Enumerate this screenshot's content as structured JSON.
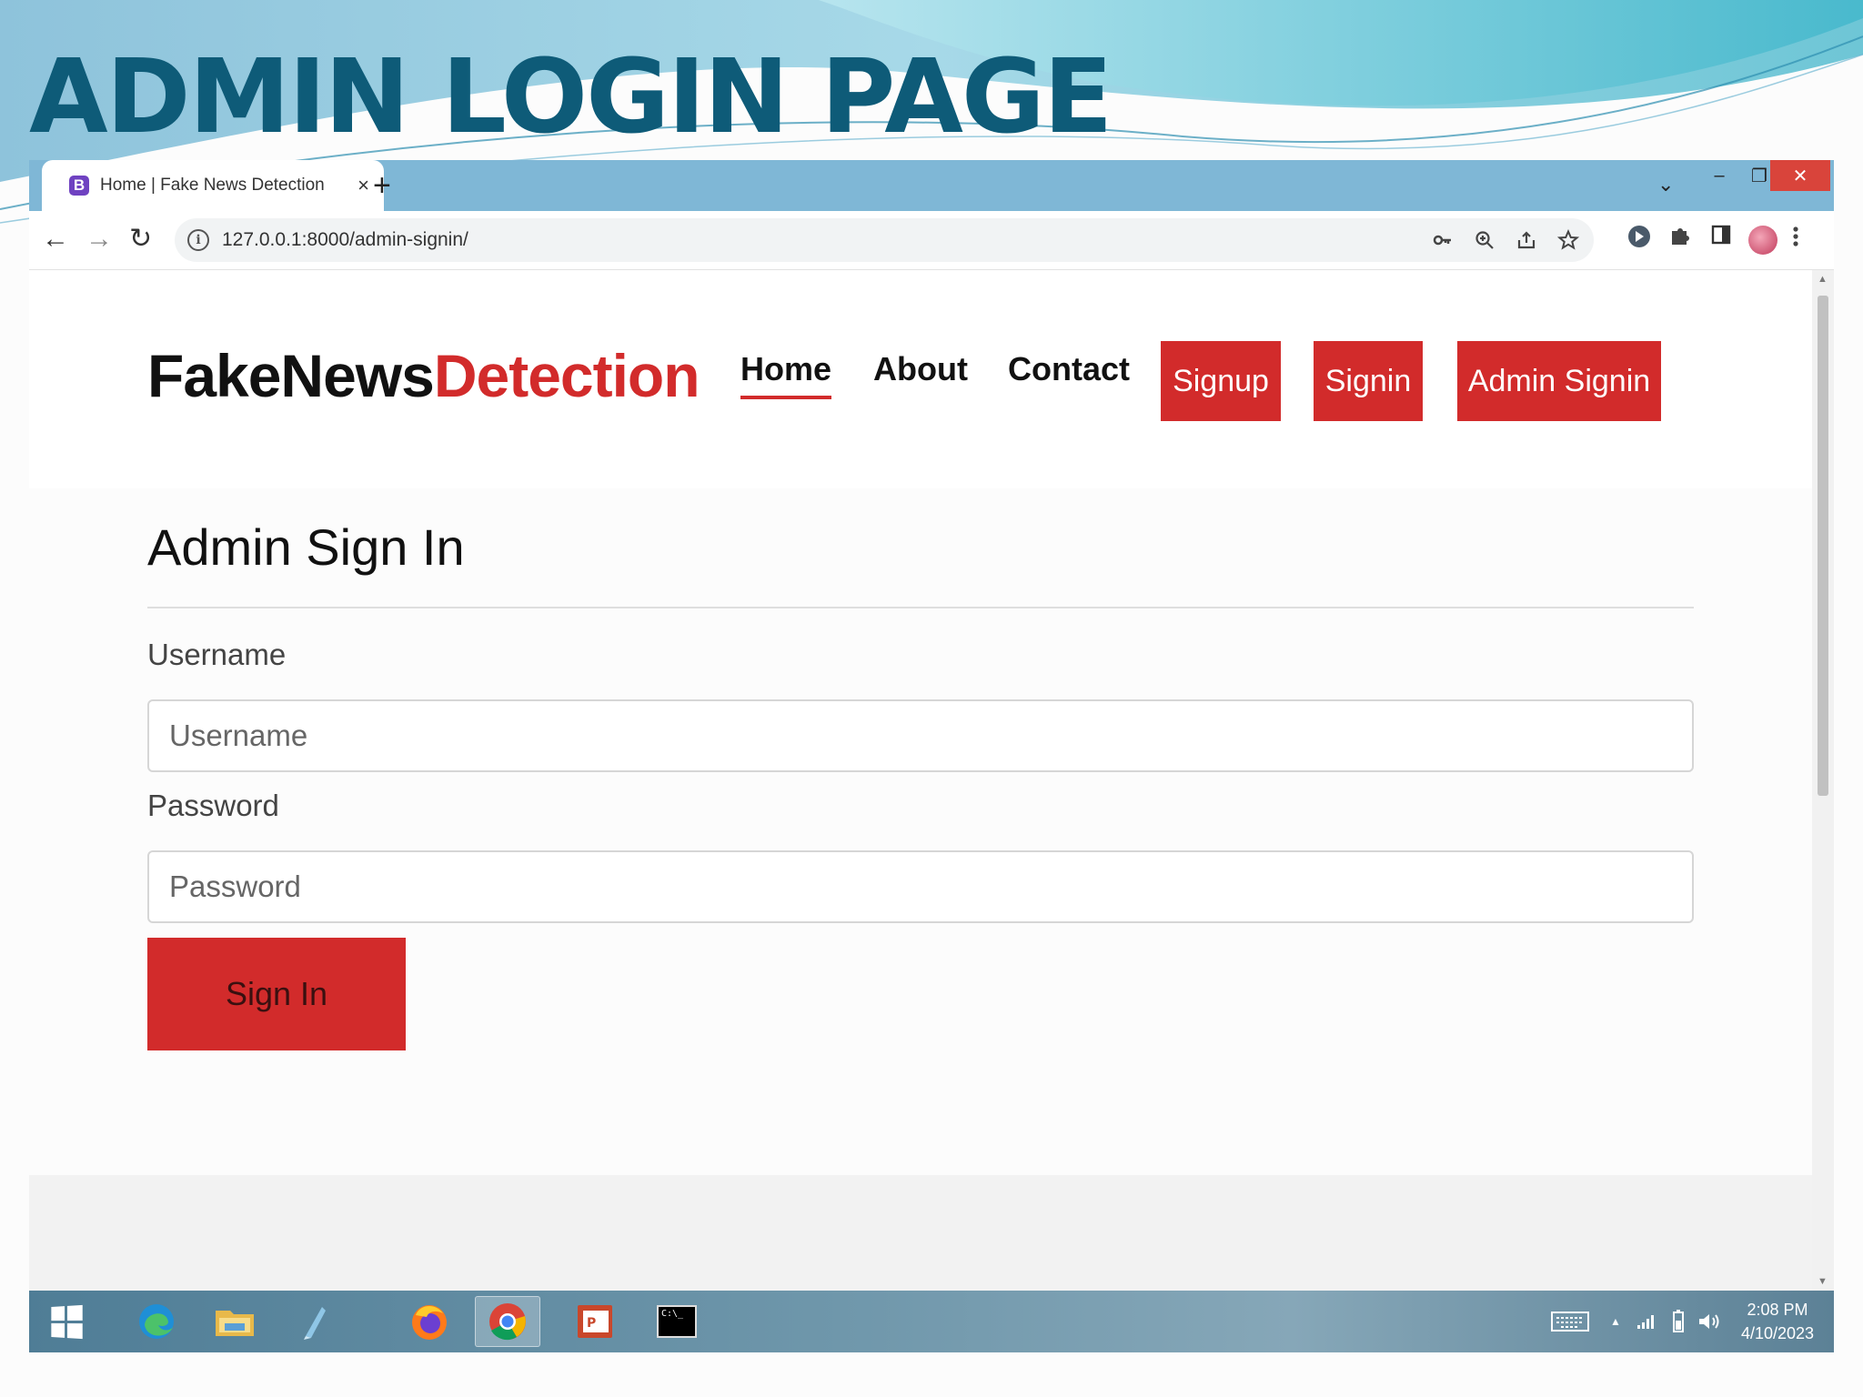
{
  "slide": {
    "title": "ADMIN LOGIN PAGE"
  },
  "browser": {
    "tab": {
      "favicon": "B",
      "title": "Home | Fake News Detection",
      "close": "×"
    },
    "new_tab": "+",
    "window_controls": {
      "search_tabs": "⌄",
      "minimize": "–",
      "maximize": "❐",
      "close": "✕"
    },
    "toolbar": {
      "back": "←",
      "forward": "→",
      "reload": "↻",
      "url": "127.0.0.1:8000/admin-signin/"
    },
    "omnibox_icons": [
      "key-icon",
      "zoom-icon",
      "share-icon",
      "star-icon"
    ],
    "extension_icons": [
      "extension-badge-icon",
      "puzzle-icon",
      "sidepanel-icon",
      "profile-avatar",
      "kebab-menu-icon"
    ]
  },
  "site": {
    "logo": {
      "part1": "FakeNews",
      "part2": "Detection"
    },
    "nav": {
      "home": "Home",
      "about": "About",
      "contact": "Contact"
    },
    "buttons": {
      "signup": "Signup",
      "signin": "Signin",
      "admin_signin": "Admin Signin"
    },
    "colors": {
      "accent": "#d22b2b",
      "text": "#111111"
    }
  },
  "form": {
    "title": "Admin Sign In",
    "username_label": "Username",
    "username_placeholder": "Username",
    "username_value": "",
    "password_label": "Password",
    "password_placeholder": "Password",
    "password_value": "",
    "submit_label": "Sign In"
  },
  "taskbar": {
    "apps": [
      "windows-start",
      "edge",
      "file-explorer",
      "app-pen",
      "firefox",
      "chrome",
      "powerpoint",
      "command-prompt"
    ],
    "cmd_label": "C:\\_",
    "clock": {
      "time": "2:08 PM",
      "date": "4/10/2023"
    }
  }
}
